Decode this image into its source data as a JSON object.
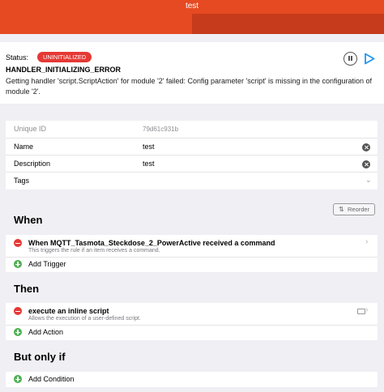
{
  "header": {
    "title": "test"
  },
  "status": {
    "label": "Status:",
    "badge": "UNINITIALIZED",
    "error_title": "HANDLER_INITIALIZING_ERROR",
    "error_message": "Getting handler 'script.ScriptAction' for module '2' failed: Config parameter 'script' is missing in the configuration of module '2'."
  },
  "details": {
    "uid_label": "Unique ID",
    "uid_value": "79d61c931b",
    "name_label": "Name",
    "name_value": "test",
    "description_label": "Description",
    "description_value": "test",
    "tags_label": "Tags"
  },
  "reorder_label": "Reorder",
  "when": {
    "title": "When",
    "trigger_title": "When MQTT_Tasmota_Steckdose_2_PowerActive received a command",
    "trigger_sub": "This triggers the rule if an item receives a command.",
    "add_label": "Add Trigger"
  },
  "then": {
    "title": "Then",
    "action_title": "execute an inline script",
    "action_sub": "Allows the execution of a user-defined script.",
    "add_label": "Add Action"
  },
  "but_only_if": {
    "title": "But only if",
    "add_label": "Add Condition"
  },
  "colors": {
    "header": "#e64a22",
    "header_tab": "#c63b1b",
    "badge": "#e53935",
    "remove": "#e53935",
    "add": "#4caf50",
    "play": "#2196f3"
  }
}
